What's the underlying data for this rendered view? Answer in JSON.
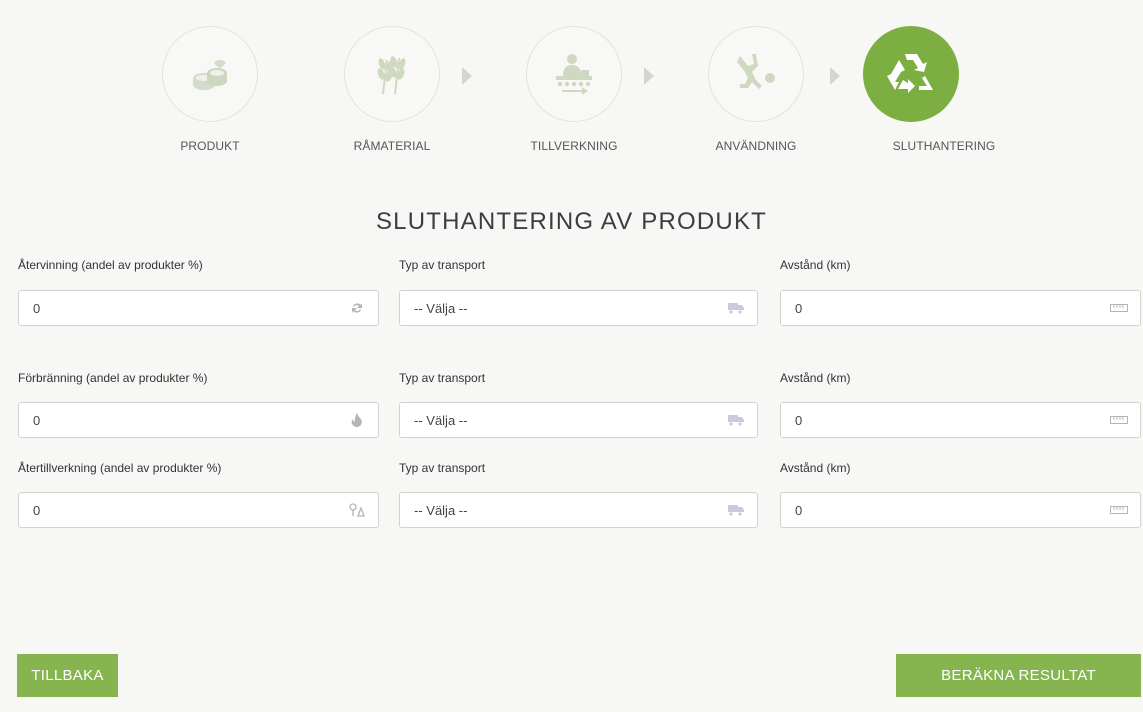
{
  "steps": [
    {
      "label": "PRODUKT",
      "icon": "product-icon",
      "active": false
    },
    {
      "label": "RÅMATERIAL",
      "icon": "wheat-icon",
      "active": false
    },
    {
      "label": "TILLVERKNING",
      "icon": "factory-worker-icon",
      "active": false
    },
    {
      "label": "ANVÄNDNING",
      "icon": "person-using-icon",
      "active": false
    },
    {
      "label": "SLUTHANTERING",
      "icon": "recycle-icon",
      "active": true
    }
  ],
  "title": "SLUTHANTERING AV PRODUKT",
  "rows": [
    {
      "share_label": "Återvinning (andel av produkter %)",
      "share_value": "0",
      "share_icon": "refresh-icon",
      "transport_label": "Typ av transport",
      "transport_value": "-- Välja --",
      "distance_label": "Avstånd (km)",
      "distance_value": "0"
    },
    {
      "share_label": "Förbränning (andel av produkter %)",
      "share_value": "0",
      "share_icon": "flame-icon",
      "transport_label": "Typ av transport",
      "transport_value": "-- Välja --",
      "distance_label": "Avstånd (km)",
      "distance_value": "0"
    },
    {
      "share_label": "Återtillverkning (andel av produkter %)",
      "share_value": "0",
      "share_icon": "remanufacture-icon",
      "transport_label": "Typ av transport",
      "transport_value": "-- Välja --",
      "distance_label": "Avstånd (km)",
      "distance_value": "0"
    }
  ],
  "buttons": {
    "back": "TILLBAKA",
    "calculate": "BERÄKNA RESULTAT"
  },
  "colors": {
    "accent": "#86b54f",
    "active_step": "#7cae41",
    "inactive_icon": "#cfd8c0"
  }
}
